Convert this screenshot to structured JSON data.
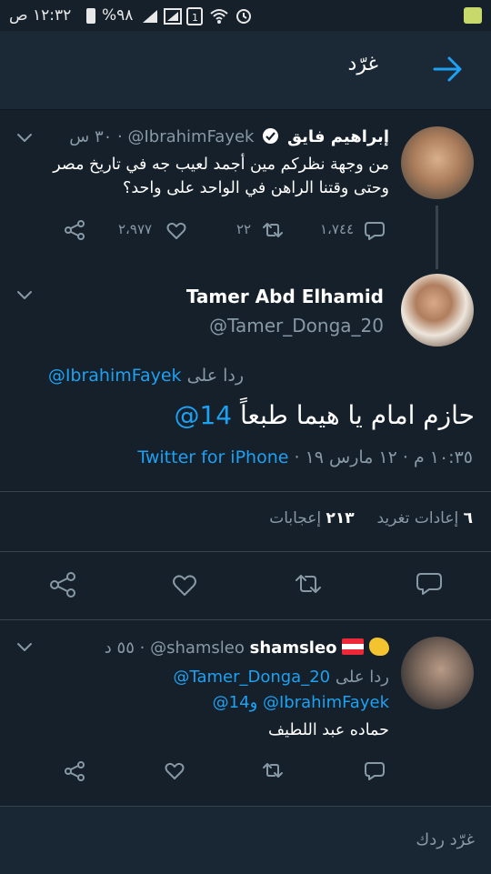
{
  "status_bar": {
    "time": "١٢:٣٢ ص",
    "battery": "%٩٨"
  },
  "header": {
    "title": "غرّد"
  },
  "parent_tweet": {
    "display_name": "إبراهيم فايق",
    "handle": "@IbrahimFayek",
    "time_ago": "٣٠ س",
    "text_line1": "من وجهة نظركم مين أجمد لعيب جه في تاريخ مصر",
    "text_line2": "وحتى وقتنا الراهن في الواحد على واحد؟",
    "replies": "١،٧٤٤",
    "retweets": "٢٢",
    "likes": "٢،٩٧٧"
  },
  "main_tweet": {
    "display_name": "Tamer Abd Elhamid",
    "handle": "@Tamer_Donga_20",
    "reply_prefix": "ردا على",
    "reply_to": "@IbrahimFayek",
    "text": "حازم امام يا هيما طبعاً",
    "mention_num": "@14",
    "timestamp": "١٠:٣٥ م · ١٢ مارس ١٩ ·",
    "source": "Twitter for iPhone",
    "retweets_count": "٦",
    "retweets_label": "إعادات تغريد",
    "likes_count": "٢١٣",
    "likes_label": "إعجابات"
  },
  "reply_tweet": {
    "display_name": "shamsleo",
    "handle": "@shamsleo",
    "time_ago": "٥٥ د",
    "reply_prefix": "ردا على",
    "reply_to_1": "@Tamer_Donga_20",
    "reply_to_2": "@IbrahimFayek",
    "reply_to_and": "و14@",
    "text": "حماده عبد اللطيف"
  },
  "compose": {
    "placeholder": "غرّد ردك"
  },
  "colors": {
    "background": "#15202b",
    "accent": "#1da1f2",
    "muted": "#8899a6"
  }
}
